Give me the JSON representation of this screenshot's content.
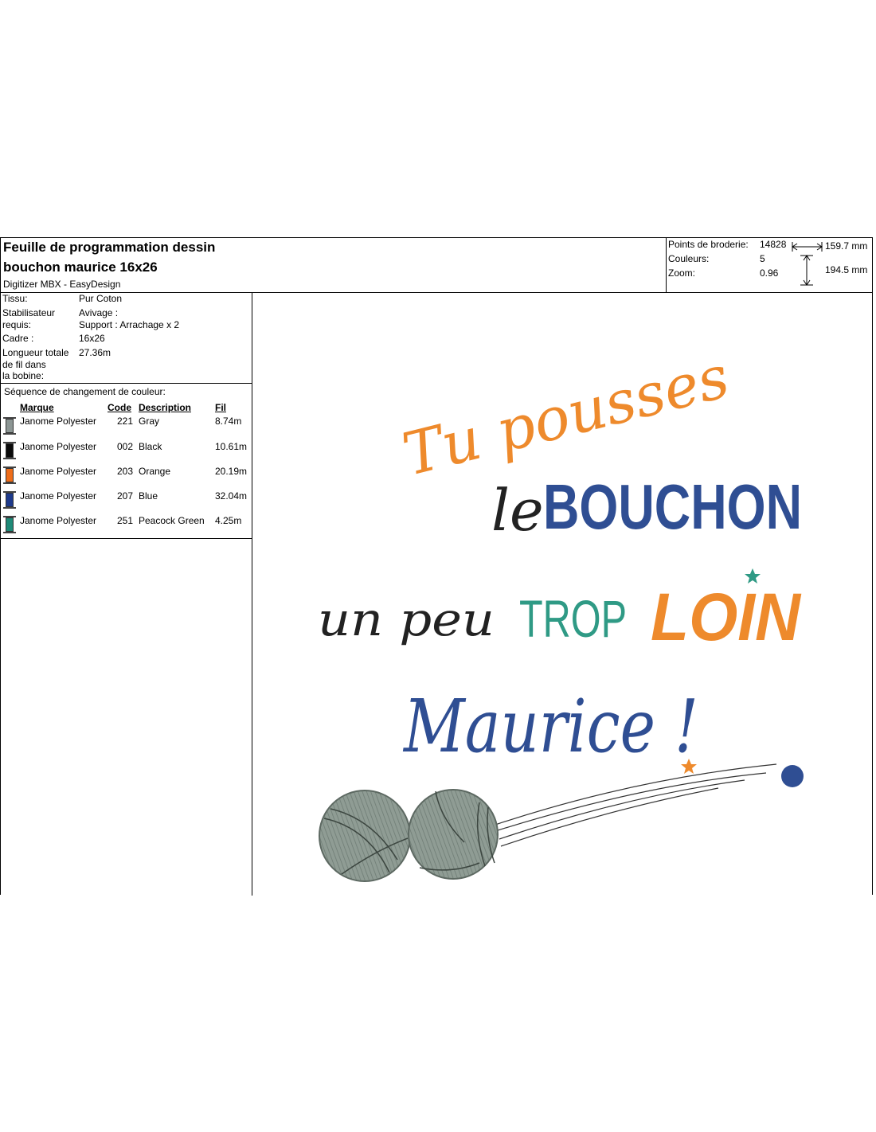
{
  "header": {
    "title_line1": "Feuille de programmation dessin",
    "title_line2": "bouchon maurice 16x26",
    "software": "Digitizer MBX - EasyDesign"
  },
  "stats": {
    "stitches_label": "Points de broderie:",
    "stitches_value": "14828",
    "colors_label": "Couleurs:",
    "colors_value": "5",
    "zoom_label": "Zoom:",
    "zoom_value": "0.96",
    "width": "159.7 mm",
    "height": "194.5 mm"
  },
  "info": {
    "fabric_label": "Tissu:",
    "fabric_value": "Pur Coton",
    "stabilizer_label_1": "Stabilisateur",
    "stabilizer_label_2": "requis:",
    "stabilizer_value_1": "Avivage :",
    "stabilizer_value_2": "Support : Arrachage x 2",
    "frame_label": "Cadre :",
    "frame_value": "16x26",
    "thread_label_1": "Longueur totale",
    "thread_label_2": "de fil dans",
    "thread_label_3": "la bobine:",
    "thread_value": "27.36m"
  },
  "sequence": {
    "title": "Séquence de changement de couleur:",
    "columns": {
      "brand": "Marque",
      "code": "Code",
      "description": "Description",
      "thread": "Fil"
    },
    "rows": [
      {
        "brand": "Janome Polyester",
        "code": "221",
        "description": "Gray",
        "length": "8.74m",
        "color": "#8c9694"
      },
      {
        "brand": "Janome Polyester",
        "code": "002",
        "description": "Black",
        "length": "10.61m",
        "color": "#0a0a0a"
      },
      {
        "brand": "Janome Polyester",
        "code": "203",
        "description": "Orange",
        "length": "20.19m",
        "color": "#ee6d1a"
      },
      {
        "brand": "Janome Polyester",
        "code": "207",
        "description": "Blue",
        "length": "32.04m",
        "color": "#1e3a8c"
      },
      {
        "brand": "Janome Polyester",
        "code": "251",
        "description": "Peacock Green",
        "length": "4.25m",
        "color": "#1f8a78"
      }
    ]
  },
  "design": {
    "line1": "Tu pousses",
    "line2a": "le",
    "line2b": "BOUCHON",
    "line3a": "un peu",
    "line3b": "TROP",
    "line3c": "LOIN",
    "line4": "Maurice !",
    "colors": {
      "orange": "#ee8a2c",
      "blue": "#2f4e93",
      "black": "#222222",
      "green": "#2f9a85",
      "gray": "#8a9890"
    }
  }
}
